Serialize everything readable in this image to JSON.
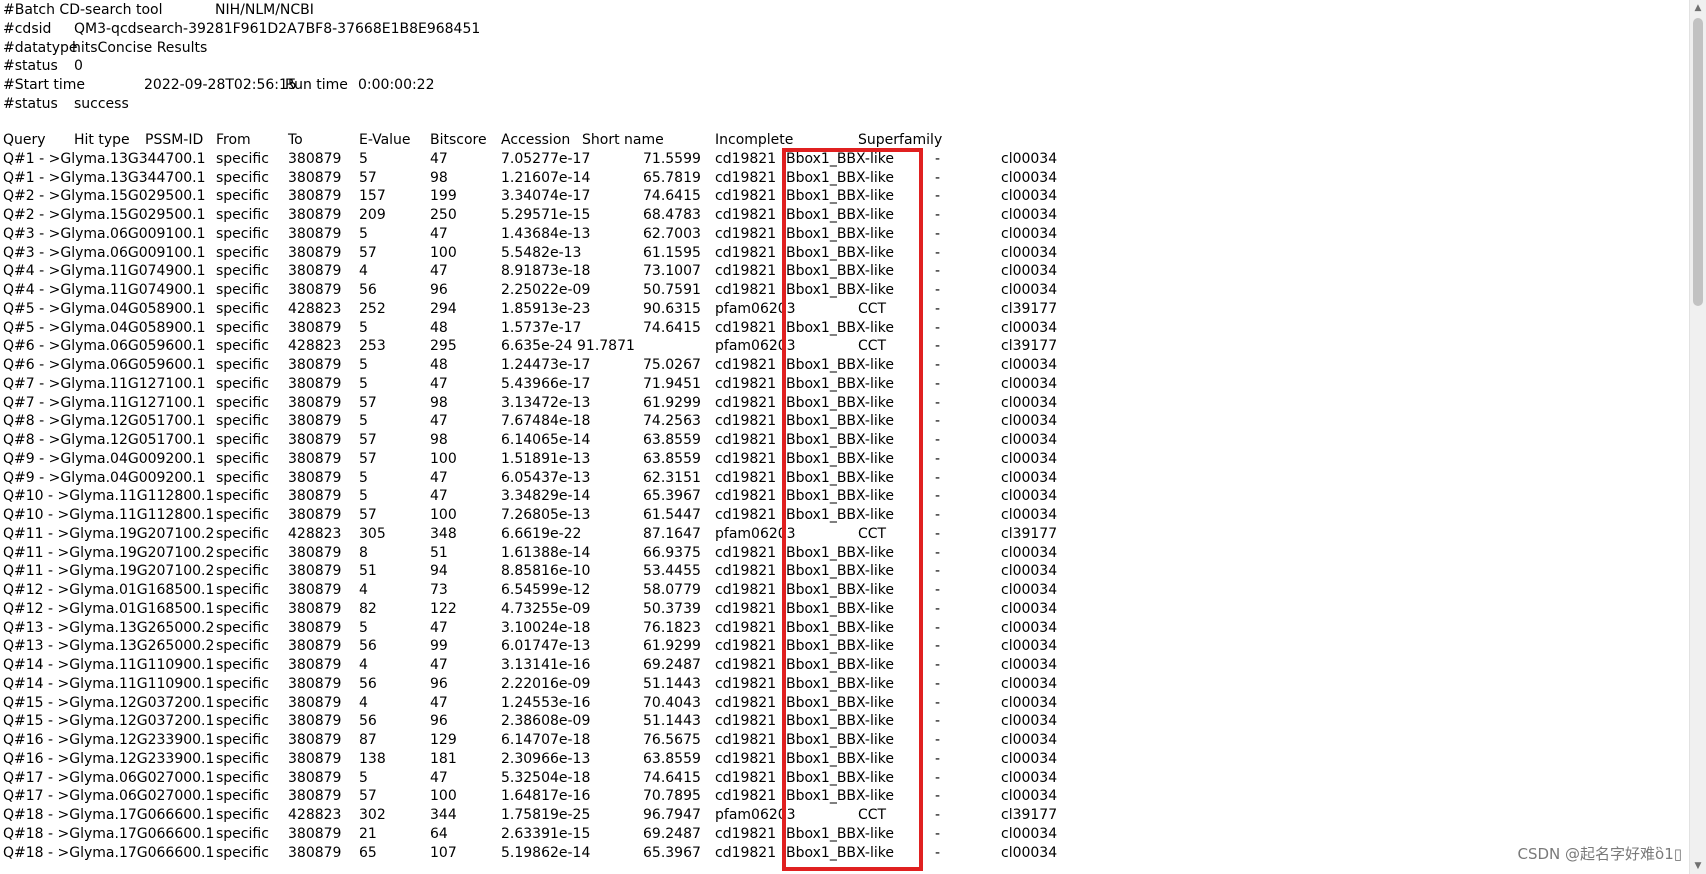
{
  "meta_lines": [
    [
      "#Batch CD-search tool",
      "NIH/NLM/NCBI"
    ],
    [
      "#cdsid",
      "QM3-qcdsearch-39281F961D2A7BF8-37668E1B8E968451"
    ],
    [
      "#datatype",
      "hitsConcise Results"
    ],
    [
      "#status",
      "0"
    ],
    [
      "#Start time",
      "2022-09-28T02:56:15",
      "Run time",
      "0:00:00:22"
    ],
    [
      "#status",
      "success"
    ]
  ],
  "headers": [
    "Query",
    "Hit type",
    "PSSM-ID",
    "From",
    "To",
    "E-Value",
    "Bitscore",
    "Accession",
    "Short name",
    "Incomplete",
    "Superfamily"
  ],
  "rows": [
    [
      "Q#1 - >Glyma.13G344700.1",
      "specific",
      "380879",
      "5",
      "47",
      "7.05277e-17",
      "71.5599",
      "cd19821",
      "Bbox1_BBX-like",
      "-",
      "cl00034"
    ],
    [
      "Q#1 - >Glyma.13G344700.1",
      "specific",
      "380879",
      "57",
      "98",
      "1.21607e-14",
      "65.7819",
      "cd19821",
      "Bbox1_BBX-like",
      "-",
      "cl00034"
    ],
    [
      "Q#2 - >Glyma.15G029500.1",
      "specific",
      "380879",
      "157",
      "199",
      "3.34074e-17",
      "74.6415",
      "cd19821",
      "Bbox1_BBX-like",
      "-",
      "cl00034"
    ],
    [
      "Q#2 - >Glyma.15G029500.1",
      "specific",
      "380879",
      "209",
      "250",
      "5.29571e-15",
      "68.4783",
      "cd19821",
      "Bbox1_BBX-like",
      "-",
      "cl00034"
    ],
    [
      "Q#3 - >Glyma.06G009100.1",
      "specific",
      "380879",
      "5",
      "47",
      "1.43684e-13",
      "62.7003",
      "cd19821",
      "Bbox1_BBX-like",
      "-",
      "cl00034"
    ],
    [
      "Q#3 - >Glyma.06G009100.1",
      "specific",
      "380879",
      "57",
      "100",
      "5.5482e-13",
      "61.1595",
      "cd19821",
      "Bbox1_BBX-like",
      "-",
      "cl00034"
    ],
    [
      "Q#4 - >Glyma.11G074900.1",
      "specific",
      "380879",
      "4",
      "47",
      "8.91873e-18",
      "73.1007",
      "cd19821",
      "Bbox1_BBX-like",
      "-",
      "cl00034"
    ],
    [
      "Q#4 - >Glyma.11G074900.1",
      "specific",
      "380879",
      "56",
      "96",
      "2.25022e-09",
      "50.7591",
      "cd19821",
      "Bbox1_BBX-like",
      "-",
      "cl00034"
    ],
    [
      "Q#5 - >Glyma.04G058900.1",
      "specific",
      "428823",
      "252",
      "294",
      "1.85913e-23",
      "90.6315",
      "pfam06203",
      "CCT",
      "-",
      "cl39177"
    ],
    [
      "Q#5 - >Glyma.04G058900.1",
      "specific",
      "380879",
      "5",
      "48",
      "1.5737e-17",
      "74.6415",
      "cd19821",
      "Bbox1_BBX-like",
      "-",
      "cl00034"
    ],
    [
      "Q#6 - >Glyma.06G059600.1",
      "specific",
      "428823",
      "253",
      "295",
      "6.635e-24 91.7871",
      "",
      "pfam06203",
      "CCT",
      "-",
      "cl39177"
    ],
    [
      "Q#6 - >Glyma.06G059600.1",
      "specific",
      "380879",
      "5",
      "48",
      "1.24473e-17",
      "75.0267",
      "cd19821",
      "Bbox1_BBX-like",
      "-",
      "cl00034"
    ],
    [
      "Q#7 - >Glyma.11G127100.1",
      "specific",
      "380879",
      "5",
      "47",
      "5.43966e-17",
      "71.9451",
      "cd19821",
      "Bbox1_BBX-like",
      "-",
      "cl00034"
    ],
    [
      "Q#7 - >Glyma.11G127100.1",
      "specific",
      "380879",
      "57",
      "98",
      "3.13472e-13",
      "61.9299",
      "cd19821",
      "Bbox1_BBX-like",
      "-",
      "cl00034"
    ],
    [
      "Q#8 - >Glyma.12G051700.1",
      "specific",
      "380879",
      "5",
      "47",
      "7.67484e-18",
      "74.2563",
      "cd19821",
      "Bbox1_BBX-like",
      "-",
      "cl00034"
    ],
    [
      "Q#8 - >Glyma.12G051700.1",
      "specific",
      "380879",
      "57",
      "98",
      "6.14065e-14",
      "63.8559",
      "cd19821",
      "Bbox1_BBX-like",
      "-",
      "cl00034"
    ],
    [
      "Q#9 - >Glyma.04G009200.1",
      "specific",
      "380879",
      "57",
      "100",
      "1.51891e-13",
      "63.8559",
      "cd19821",
      "Bbox1_BBX-like",
      "-",
      "cl00034"
    ],
    [
      "Q#9 - >Glyma.04G009200.1",
      "specific",
      "380879",
      "5",
      "47",
      "6.05437e-13",
      "62.3151",
      "cd19821",
      "Bbox1_BBX-like",
      "-",
      "cl00034"
    ],
    [
      "Q#10 - >Glyma.11G112800.1",
      "specific",
      "380879",
      "5",
      "47",
      "3.34829e-14",
      "65.3967",
      "cd19821",
      "Bbox1_BBX-like",
      "-",
      "cl00034"
    ],
    [
      "Q#10 - >Glyma.11G112800.1",
      "specific",
      "380879",
      "57",
      "100",
      "7.26805e-13",
      "61.5447",
      "cd19821",
      "Bbox1_BBX-like",
      "-",
      "cl00034"
    ],
    [
      "Q#11 - >Glyma.19G207100.2",
      "specific",
      "428823",
      "305",
      "348",
      "6.6619e-22",
      "87.1647",
      "pfam06203",
      "CCT",
      "-",
      "cl39177"
    ],
    [
      "Q#11 - >Glyma.19G207100.2",
      "specific",
      "380879",
      "8",
      "51",
      "1.61388e-14",
      "66.9375",
      "cd19821",
      "Bbox1_BBX-like",
      "-",
      "cl00034"
    ],
    [
      "Q#11 - >Glyma.19G207100.2",
      "specific",
      "380879",
      "51",
      "94",
      "8.85816e-10",
      "53.4455",
      "cd19821",
      "Bbox1_BBX-like",
      "-",
      "cl00034"
    ],
    [
      "Q#12 - >Glyma.01G168500.1",
      "specific",
      "380879",
      "4",
      "73",
      "6.54599e-12",
      "58.0779",
      "cd19821",
      "Bbox1_BBX-like",
      "-",
      "cl00034"
    ],
    [
      "Q#12 - >Glyma.01G168500.1",
      "specific",
      "380879",
      "82",
      "122",
      "4.73255e-09",
      "50.3739",
      "cd19821",
      "Bbox1_BBX-like",
      "-",
      "cl00034"
    ],
    [
      "Q#13 - >Glyma.13G265000.2",
      "specific",
      "380879",
      "5",
      "47",
      "3.10024e-18",
      "76.1823",
      "cd19821",
      "Bbox1_BBX-like",
      "-",
      "cl00034"
    ],
    [
      "Q#13 - >Glyma.13G265000.2",
      "specific",
      "380879",
      "56",
      "99",
      "6.01747e-13",
      "61.9299",
      "cd19821",
      "Bbox1_BBX-like",
      "-",
      "cl00034"
    ],
    [
      "Q#14 - >Glyma.11G110900.1",
      "specific",
      "380879",
      "4",
      "47",
      "3.13141e-16",
      "69.2487",
      "cd19821",
      "Bbox1_BBX-like",
      "-",
      "cl00034"
    ],
    [
      "Q#14 - >Glyma.11G110900.1",
      "specific",
      "380879",
      "56",
      "96",
      "2.22016e-09",
      "51.1443",
      "cd19821",
      "Bbox1_BBX-like",
      "-",
      "cl00034"
    ],
    [
      "Q#15 - >Glyma.12G037200.1",
      "specific",
      "380879",
      "4",
      "47",
      "1.24553e-16",
      "70.4043",
      "cd19821",
      "Bbox1_BBX-like",
      "-",
      "cl00034"
    ],
    [
      "Q#15 - >Glyma.12G037200.1",
      "specific",
      "380879",
      "56",
      "96",
      "2.38608e-09",
      "51.1443",
      "cd19821",
      "Bbox1_BBX-like",
      "-",
      "cl00034"
    ],
    [
      "Q#16 - >Glyma.12G233900.1",
      "specific",
      "380879",
      "87",
      "129",
      "6.14707e-18",
      "76.5675",
      "cd19821",
      "Bbox1_BBX-like",
      "-",
      "cl00034"
    ],
    [
      "Q#16 - >Glyma.12G233900.1",
      "specific",
      "380879",
      "138",
      "181",
      "2.30966e-13",
      "63.8559",
      "cd19821",
      "Bbox1_BBX-like",
      "-",
      "cl00034"
    ],
    [
      "Q#17 - >Glyma.06G027000.1",
      "specific",
      "380879",
      "5",
      "47",
      "5.32504e-18",
      "74.6415",
      "cd19821",
      "Bbox1_BBX-like",
      "-",
      "cl00034"
    ],
    [
      "Q#17 - >Glyma.06G027000.1",
      "specific",
      "380879",
      "57",
      "100",
      "1.64817e-16",
      "70.7895",
      "cd19821",
      "Bbox1_BBX-like",
      "-",
      "cl00034"
    ],
    [
      "Q#18 - >Glyma.17G066600.1",
      "specific",
      "428823",
      "302",
      "344",
      "1.75819e-25",
      "96.7947",
      "pfam06203",
      "CCT",
      "-",
      "cl39177"
    ],
    [
      "Q#18 - >Glyma.17G066600.1",
      "specific",
      "380879",
      "21",
      "64",
      "2.63391e-15",
      "69.2487",
      "cd19821",
      "Bbox1_BBX-like",
      "-",
      "cl00034"
    ],
    [
      "Q#18 - >Glyma.17G066600.1",
      "specific",
      "380879",
      "65",
      "107",
      "5.19862e-14",
      "65.3967",
      "cd19821",
      "Bbox1_BBX-like",
      "-",
      "cl00034"
    ]
  ],
  "watermark": "CSDN @起名字好难ὃ1▯",
  "colors": {
    "highlight": "#e02020",
    "text": "#000000",
    "scrollbar": "#f0f0f0"
  }
}
